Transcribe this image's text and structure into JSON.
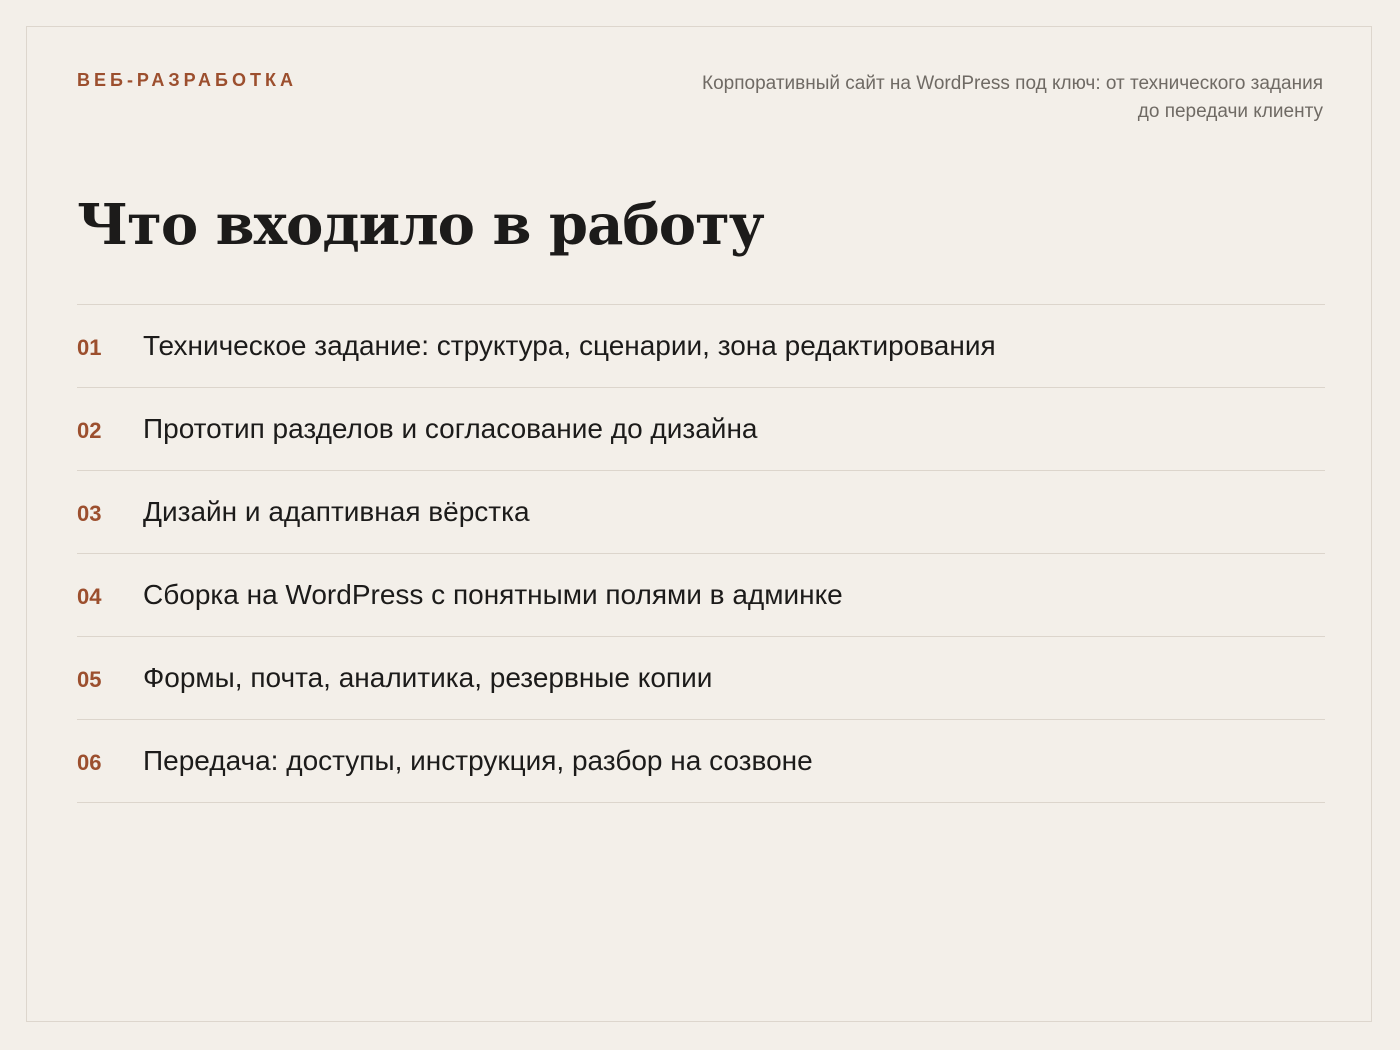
{
  "header": {
    "eyebrow": "ВЕБ-РАЗРАБОТКА",
    "subtitle": "Корпоративный сайт на WordPress под ключ: от технического задания до передачи клиенту"
  },
  "main": {
    "title": "Что входило в работу",
    "items": [
      {
        "num": "01",
        "text": "Техническое задание: структура, сценарии, зона редактирования"
      },
      {
        "num": "02",
        "text": "Прототип разделов и согласование до дизайна"
      },
      {
        "num": "03",
        "text": "Дизайн и адаптивная вёрстка"
      },
      {
        "num": "04",
        "text": "Сборка на WordPress с понятными полями в админке"
      },
      {
        "num": "05",
        "text": "Формы, почта, аналитика, резервные копии"
      },
      {
        "num": "06",
        "text": "Передача: доступы, инструкция, разбор на созвоне"
      }
    ]
  },
  "colors": {
    "background": "#f3efe9",
    "accent": "#9c4f2e",
    "text": "#1c1b1a",
    "muted": "#6f6a64",
    "divider": "#dcd5cc"
  }
}
